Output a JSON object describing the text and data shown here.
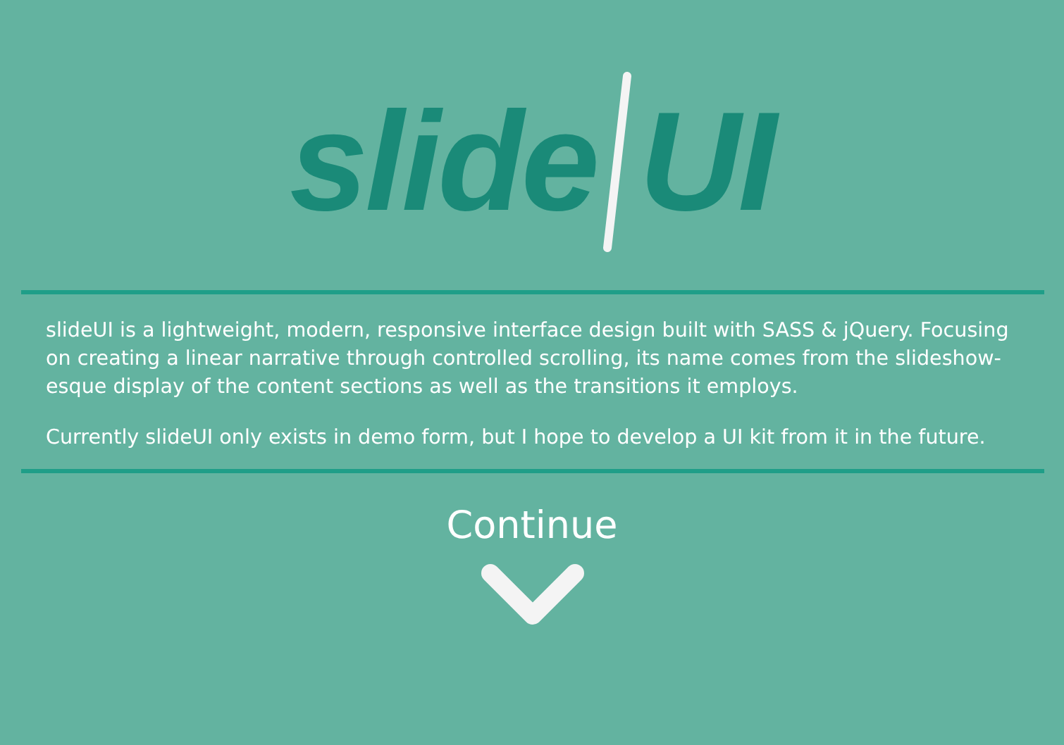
{
  "logo": {
    "word": "slide",
    "suffix": "UI"
  },
  "paragraphs": [
    "slideUI is a lightweight, modern, responsive interface design built with SASS & jQuery. Focusing on creating a linear narrative through controlled scrolling, its name comes from the slideshow-esque display of the content sections as well as the transitions it employs.",
    "Currently slideUI only exists in demo form, but I hope to develop a UI kit from it in the future."
  ],
  "continue": {
    "label": "Continue"
  }
}
